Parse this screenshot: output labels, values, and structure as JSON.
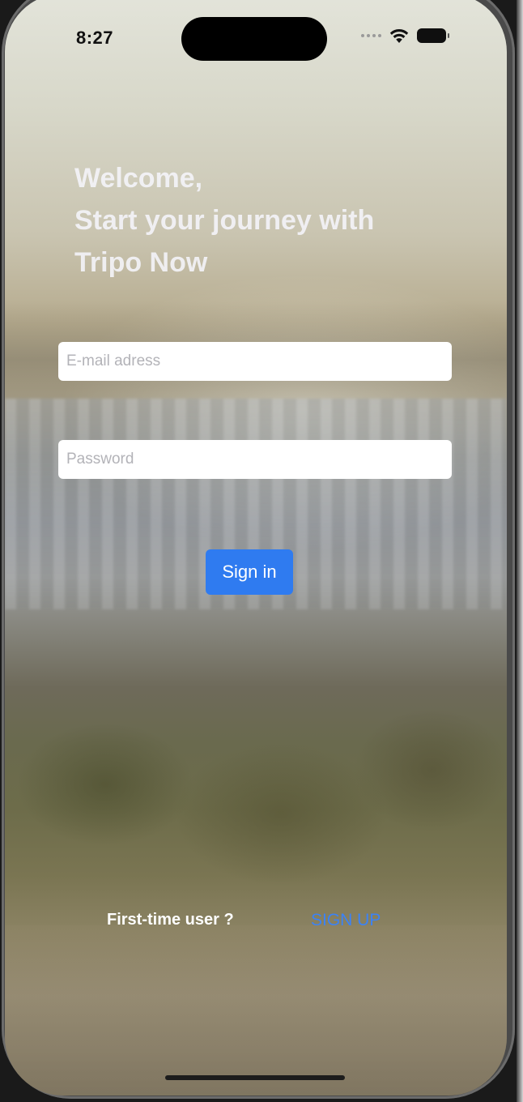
{
  "status_bar": {
    "time": "8:27",
    "icons": [
      "signal-dots-icon",
      "wifi-icon",
      "battery-icon"
    ]
  },
  "welcome": {
    "line1": "Welcome,",
    "line2": "Start your journey with",
    "line3": "Tripo Now"
  },
  "form": {
    "email_placeholder": "E-mail adress",
    "email_value": "",
    "password_placeholder": "Password",
    "password_value": "",
    "signin_label": "Sign in"
  },
  "footer": {
    "prompt": "First-time user ?",
    "signup_label": "SIGN UP"
  },
  "colors": {
    "accent": "#2f7bf0",
    "link": "#3b82f6",
    "field_bg": "#ffffff"
  }
}
